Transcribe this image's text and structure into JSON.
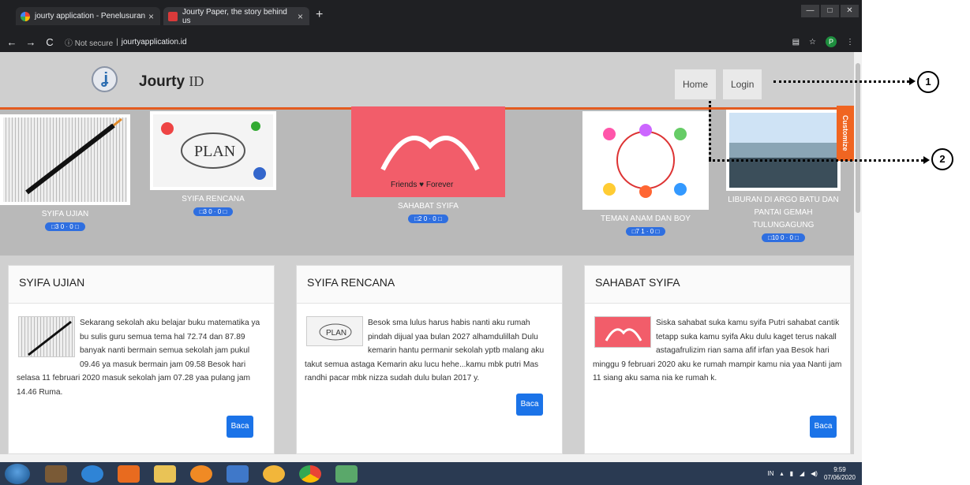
{
  "browser": {
    "tabs": [
      {
        "title": "jourty application - Penelusuran",
        "close": "×"
      },
      {
        "title": "Jourty Paper, the story behind us",
        "close": "×"
      }
    ],
    "new_tab": "+",
    "window_controls": [
      "—",
      "□",
      "✕"
    ],
    "nav": {
      "back": "←",
      "forward": "→",
      "reload": "C"
    },
    "address": {
      "security": "ⓘ Not secure",
      "separator": "|",
      "url": "jourtyapplication.id"
    },
    "profile_initial": "P"
  },
  "site": {
    "brand_bold": "Jourty",
    "brand_light": "ID",
    "nav": {
      "home": "Home",
      "login": "Login"
    },
    "customize": "Customize"
  },
  "slider": [
    {
      "caption": "SYIFA UJIAN",
      "stats": "□3  0 · 0 □"
    },
    {
      "caption": "SYIFA RENCANA",
      "stats": "□3  0 · 0 □"
    },
    {
      "caption": "SAHABAT SYIFA",
      "stats": "□2  0 · 0 □",
      "image_text": "Friends ♥ Forever"
    },
    {
      "caption": "TEMAN ANAM DAN BOY",
      "stats": "□7  1 · 0 □"
    },
    {
      "caption": "LIBURAN DI ARGO BATU DAN PANTAI GEMAH TULUNGAGUNG",
      "stats": "□10  0 · 0 □"
    }
  ],
  "cards": [
    {
      "title": "SYIFA UJIAN",
      "text": "Sekarang sekolah aku belajar buku matematika ya bu sulis guru semua tema hal 72.74 dan 87.89 banyak nanti bermain semua sekolah jam pukul 09.46 ya masuk bermain jam 09.58 Besok hari selasa 11 februari 2020 masuk sekolah jam 07.28 yaa pulang jam 14.46 Ruma.",
      "button": "Baca"
    },
    {
      "title": "SYIFA RENCANA",
      "text": "Besok sma lulus harus habis nanti aku rumah pindah dijual yaa bulan 2027 alhamdulillah  Dulu kemarin hantu permanir sekolah yptb malang aku takut semua astaga Kemarin aku lucu hehe...kamu mbk putri Mas randhi pacar mbk nizza sudah dulu bulan 2017 y.",
      "button": "Baca"
    },
    {
      "title": "SAHABAT SYIFA",
      "text": "Siska sahabat suka kamu syifa Putri sahabat cantik tetapp suka kamu syifa Aku dulu kaget terus nakall astagafrulizim rian sama afif irfan yaa Besok hari minggu 9 februari 2020 aku ke rumah mampir kamu nia yaa Nanti jam 11 siang aku sama nia ke rumah k.",
      "button": "Baca"
    }
  ],
  "callouts": [
    "1",
    "2"
  ],
  "taskbar": {
    "time": "9:59",
    "date": "07/06/2020",
    "lang": "IN"
  },
  "colors": {
    "accent": "#e35b1f",
    "button": "#1b73e8",
    "pill": "#2f6fe0",
    "customize": "#f06521"
  }
}
